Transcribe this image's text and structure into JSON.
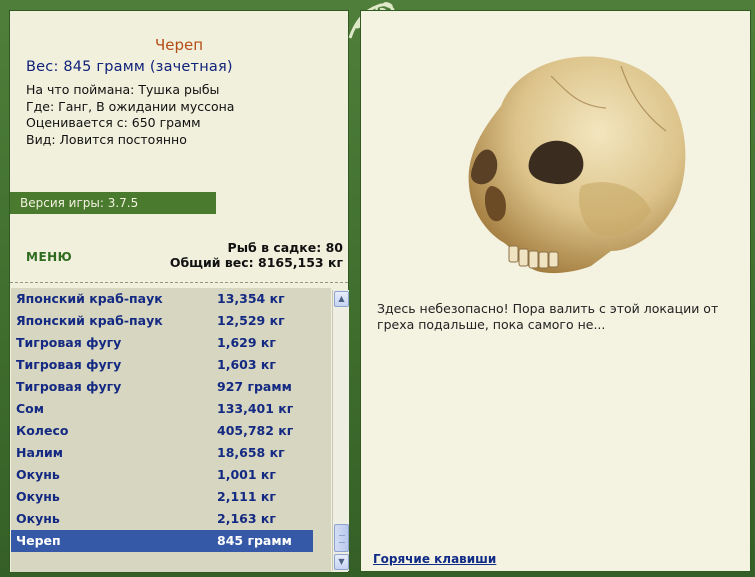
{
  "item": {
    "title": "Череп",
    "weight_line": "Вес: 845 грамм (зачетная)",
    "details": [
      "На что поймана: Тушка рыбы",
      "Где: Ганг, В ожидании муссона",
      "Оценивается с: 650 грамм",
      "Вид: Ловится постоянно"
    ]
  },
  "version": "Версия игры: 3.7.5",
  "menu_label": "МЕНЮ",
  "stats": {
    "fish_count": "Рыб в садке: 80",
    "total_weight": "Общий вес: 8165,153 кг"
  },
  "fish_list": [
    {
      "name": "Японский краб-паук",
      "weight": "13,354 кг"
    },
    {
      "name": "Японский краб-паук",
      "weight": "12,529 кг"
    },
    {
      "name": "Тигровая фугу",
      "weight": "1,629 кг"
    },
    {
      "name": "Тигровая фугу",
      "weight": "1,603 кг"
    },
    {
      "name": "Тигровая фугу",
      "weight": "927 грамм"
    },
    {
      "name": "Сом",
      "weight": "133,401 кг"
    },
    {
      "name": "Колесо",
      "weight": "405,782 кг"
    },
    {
      "name": "Налим",
      "weight": "18,658 кг"
    },
    {
      "name": "Окунь",
      "weight": "1,001 кг"
    },
    {
      "name": "Окунь",
      "weight": "2,111 кг"
    },
    {
      "name": "Окунь",
      "weight": "2,163 кг"
    },
    {
      "name": "Череп",
      "weight": "845 грамм",
      "selected": true
    }
  ],
  "location_text": "Здесь небезопасно! Пора валить с этой локации от греха подальше, пока самого не...",
  "hotkeys_label": "Горячие клавиши",
  "colors": {
    "frame": "#3f6e2e",
    "panel": "#f1f0dd",
    "list_bg": "#d7d6c0",
    "fish_text": "#142a82",
    "selected_row": "#3559a6",
    "title": "#b44d14"
  }
}
